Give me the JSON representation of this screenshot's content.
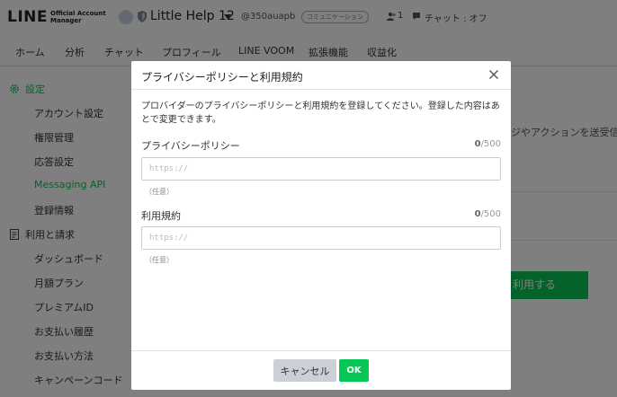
{
  "header": {
    "logo_main": "LINE",
    "logo_sub_line1": "Official Account",
    "logo_sub_line2": "Manager",
    "account_name": "Little Help 12",
    "account_id": "@350auapb",
    "plan_badge": "コミュニケーション",
    "friends_count": "1",
    "chat_status": "チャット : オフ"
  },
  "nav": {
    "items": [
      {
        "label": "ホーム"
      },
      {
        "label": "分析"
      },
      {
        "label": "チャット"
      },
      {
        "label": "プロフィール"
      },
      {
        "label": "LINE VOOM"
      },
      {
        "label": "拡張機能"
      },
      {
        "label": "収益化"
      }
    ]
  },
  "sidebar": {
    "settings_label": "設定",
    "settings_items": [
      {
        "label": "アカウント設定"
      },
      {
        "label": "権限管理"
      },
      {
        "label": "応答設定"
      },
      {
        "label": "Messaging API"
      },
      {
        "label": "登録情報"
      }
    ],
    "billing_label": "利用と請求",
    "billing_items": [
      {
        "label": "ダッシュボード"
      },
      {
        "label": "月額プラン"
      },
      {
        "label": "プレミアムID"
      },
      {
        "label": "お支払い履歴"
      },
      {
        "label": "お支払い方法"
      },
      {
        "label": "キャンペーンコード"
      }
    ]
  },
  "background": {
    "partial_text": "ジやアクションを送受信",
    "partial_button": "利用する"
  },
  "modal": {
    "title": "プライバシーポリシーと利用規約",
    "description": "プロバイダーのプライバシーポリシーと利用規約を登録してください。登録した内容はあとで変更できます。",
    "privacy": {
      "label": "プライバシーポリシー",
      "count": "0",
      "max": "/500",
      "placeholder": "https://",
      "hint": "（任意）"
    },
    "terms": {
      "label": "利用規約",
      "count": "0",
      "max": "/500",
      "placeholder": "https://",
      "hint": "（任意）"
    },
    "cancel_label": "キャンセル",
    "ok_label": "OK"
  },
  "colors": {
    "accent": "#06c755",
    "overlay": "rgba(0,0,0,0.5)"
  }
}
